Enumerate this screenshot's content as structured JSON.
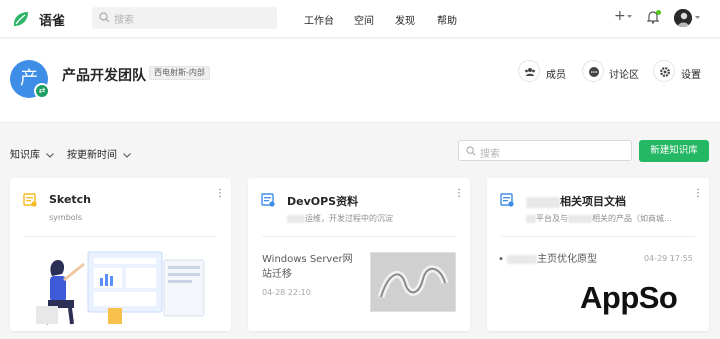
{
  "app": {
    "brand": "语雀",
    "search_placeholder": "搜索",
    "nav": [
      "工作台",
      "空间",
      "发现",
      "帮助"
    ],
    "plus_label": "+",
    "colors": {
      "primary": "#25b864",
      "avatar": "#3e8ee8",
      "dot": "#52c41a"
    }
  },
  "team": {
    "avatar_char": "产",
    "name": "产品开发团队",
    "tag": "西电射斯-内部",
    "actions": [
      {
        "label": "成员",
        "icon": "members-icon"
      },
      {
        "label": "讨论区",
        "icon": "discussion-icon"
      },
      {
        "label": "设置",
        "icon": "settings-icon"
      }
    ]
  },
  "toolbar": {
    "filter_type": "知识库",
    "sort": "按更新时间",
    "search_placeholder": "搜索",
    "new_button": "新建知识库"
  },
  "cards": [
    {
      "title": "Sketch",
      "desc": "symbols"
    },
    {
      "title": "DevOPS资料",
      "desc": "运维，开发过程中的沉淀",
      "doc_title": "Windows Server网站迁移",
      "doc_date": "04-28 22:10"
    },
    {
      "title": "相关项目文档",
      "desc": "平台及与",
      "desc2": "相关的产品（如商城...",
      "doc_bullet": "•",
      "doc_title": "主页优化原型",
      "doc_date": "04-29 17:55"
    }
  ],
  "watermark": "AppSo"
}
